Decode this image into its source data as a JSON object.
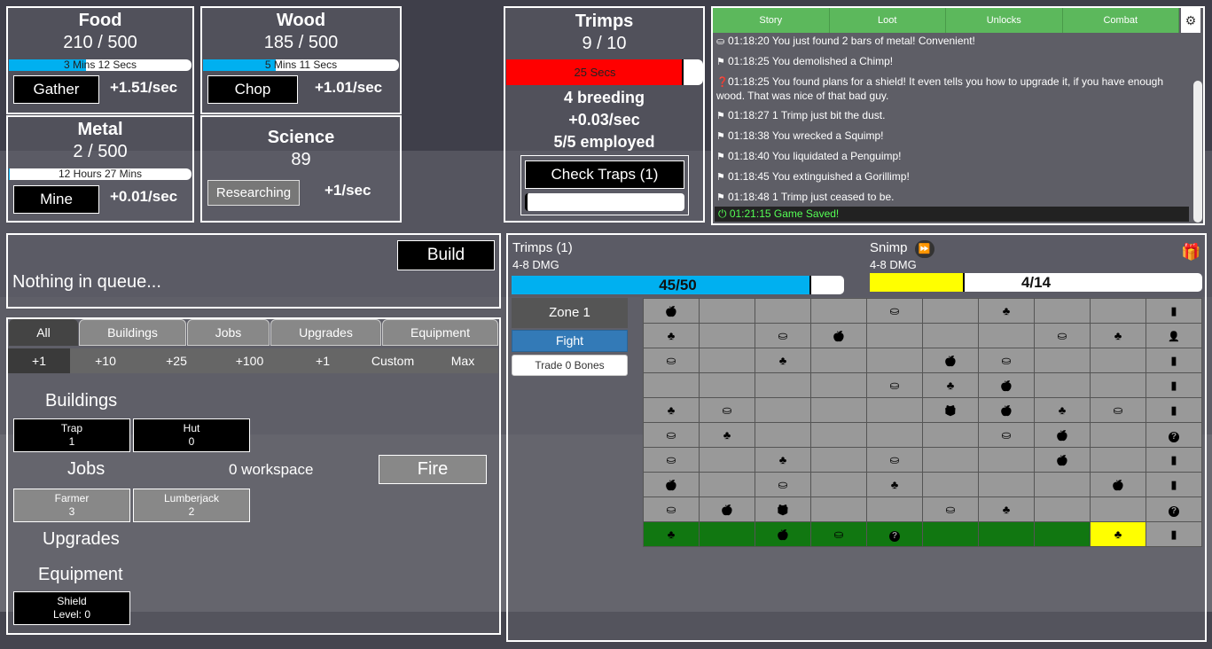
{
  "resources": {
    "food": {
      "name": "Food",
      "amount": "210 / 500",
      "bar_text": "3 Mins 12 Secs",
      "fill": 0.42,
      "button": "Gather",
      "rate": "+1.51/sec"
    },
    "wood": {
      "name": "Wood",
      "amount": "185 / 500",
      "bar_text": "5 Mins 11 Secs",
      "fill": 0.37,
      "button": "Chop",
      "rate": "+1.01/sec"
    },
    "metal": {
      "name": "Metal",
      "amount": "2 / 500",
      "bar_text": "12 Hours 27 Mins",
      "fill": 0.004,
      "button": "Mine",
      "rate": "+0.01/sec"
    },
    "science": {
      "name": "Science",
      "amount": "89",
      "button": "Researching",
      "rate": "+1/sec"
    }
  },
  "trimps": {
    "title": "Trimps",
    "count": "9 / 10",
    "bar_text": "25 Secs",
    "fill": 0.9,
    "breeding": "4 breeding",
    "rate": "+0.03/sec",
    "employed": "5/5 employed",
    "check_traps": "Check Traps (1)",
    "trap_fill": 0.0
  },
  "log": {
    "tabs": [
      "Story",
      "Loot",
      "Unlocks",
      "Combat"
    ],
    "gear_icon": "gear-icon",
    "lines": [
      {
        "icon": "metal-icon",
        "text": "01:18:20 You just found 2 bars of metal! Convenient!"
      },
      {
        "icon": "flag-icon",
        "text": "01:18:25 You demolished a Chimp!"
      },
      {
        "icon": "question-icon",
        "text": "01:18:25 You found plans for a shield! It even tells you how to upgrade it, if you have enough wood. That was nice of that bad guy."
      },
      {
        "icon": "flag-icon",
        "text": "01:18:27 1 Trimp just bit the dust."
      },
      {
        "icon": "flag-icon",
        "text": "01:18:38 You wrecked a Squimp!"
      },
      {
        "icon": "flag-icon",
        "text": "01:18:40 You liquidated a Penguimp!"
      },
      {
        "icon": "flag-icon",
        "text": "01:18:45 You extinguished a Gorillimp!"
      },
      {
        "icon": "flag-icon",
        "text": "01:18:48 1 Trimp just ceased to be."
      }
    ],
    "saved": "01:21:15 Game Saved!"
  },
  "queue": {
    "build_label": "Build",
    "text": "Nothing in queue..."
  },
  "buy": {
    "tabs": [
      "All",
      "Buildings",
      "Jobs",
      "Upgrades",
      "Equipment"
    ],
    "amounts": [
      "+1",
      "+10",
      "+25",
      "+100",
      "+1",
      "Custom",
      "Max"
    ],
    "buildings_title": "Buildings",
    "buildings": [
      {
        "name": "Trap",
        "count": "1"
      },
      {
        "name": "Hut",
        "count": "0"
      }
    ],
    "jobs_title": "Jobs",
    "workspace": "0 workspace",
    "fire_label": "Fire",
    "jobs": [
      {
        "name": "Farmer",
        "count": "3"
      },
      {
        "name": "Lumberjack",
        "count": "2"
      }
    ],
    "upgrades_title": "Upgrades",
    "equipment_title": "Equipment",
    "equipment": [
      {
        "name": "Shield",
        "level": "Level: 0"
      }
    ]
  },
  "battle": {
    "trimps_name": "Trimps (1)",
    "trimps_dmg": "4-8 DMG",
    "trimps_health": "45/50",
    "trimps_fill": 0.9,
    "enemy_name": "Snimp",
    "enemy_dmg": "4-8 DMG",
    "enemy_health": "4/14",
    "enemy_fill": 0.286,
    "zone": "Zone 1",
    "fight": "Fight",
    "trade": "Trade 0 Bones",
    "colors": {
      "trimp_bar": "#00b0f0",
      "enemy_bar": "#ffff00",
      "cleared_cell": "#117711",
      "current_cell": "#ffff00"
    }
  },
  "map_grid": [
    [
      "apple",
      "",
      "",
      "",
      "metal",
      "",
      "tree",
      "",
      "",
      "book"
    ],
    [
      "tree",
      "",
      "metal",
      "apple",
      "",
      "",
      "",
      "metal",
      "tree",
      "person"
    ],
    [
      "metal",
      "",
      "tree",
      "",
      "",
      "apple",
      "metal",
      "",
      "",
      "book"
    ],
    [
      "",
      "",
      "",
      "",
      "metal",
      "tree",
      "apple",
      "",
      "",
      "book"
    ],
    [
      "tree",
      "metal",
      "",
      "",
      "",
      "gift",
      "apple",
      "tree",
      "metal",
      "book"
    ],
    [
      "metal",
      "tree",
      "",
      "",
      "",
      "",
      "metal",
      "apple",
      "",
      "question"
    ],
    [
      "metal",
      "",
      "tree",
      "",
      "metal",
      "",
      "",
      "apple",
      "",
      "book"
    ],
    [
      "apple",
      "",
      "metal",
      "",
      "tree",
      "",
      "",
      "",
      "apple",
      "book"
    ],
    [
      "metal",
      "apple",
      "gift",
      "",
      "",
      "metal",
      "tree",
      "",
      "",
      "question"
    ],
    [
      "tree",
      "",
      "apple",
      "metal",
      "question",
      "",
      "",
      "",
      "tree",
      "book"
    ]
  ]
}
